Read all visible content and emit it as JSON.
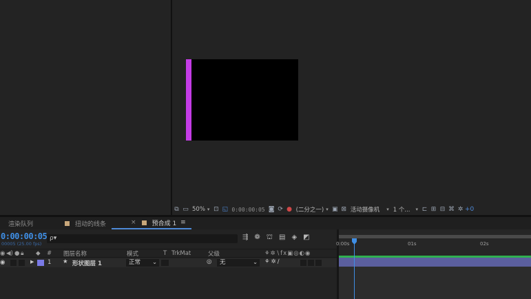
{
  "viewer_toolbar": {
    "zoom": "50%",
    "timecode": "0:00:00:05",
    "resolution": "(二分之一)",
    "camera": "活动摄像机",
    "views": "1 个...",
    "plus": "+0"
  },
  "tabs": [
    {
      "label": "渲染队列"
    },
    {
      "label": "扭动的线条"
    },
    {
      "label": "预合成 1"
    }
  ],
  "timeline": {
    "timecode": "0:00:00:05",
    "frames_label": "00005 (25.00 fps)",
    "search_placeholder": "ρ▾",
    "columns": {
      "hash": "#",
      "layer_name": "图层名称",
      "mode": "模式",
      "t": "T",
      "trkmat": "TrkMat",
      "parent": "父级"
    },
    "layers": [
      {
        "number": "1",
        "name": "形状图层 1",
        "mode": "正常",
        "parent": "无"
      }
    ],
    "ruler": {
      "ticks": [
        "0:00s",
        "01s",
        "02s"
      ]
    }
  },
  "colors": {
    "accent_blue": "#3f8fe6",
    "comp_bar_purple": "#c43ce6",
    "layer_label": "#7a7ae6",
    "layer_bar": "#5b5f9e",
    "work_area_green": "#2fb050"
  }
}
